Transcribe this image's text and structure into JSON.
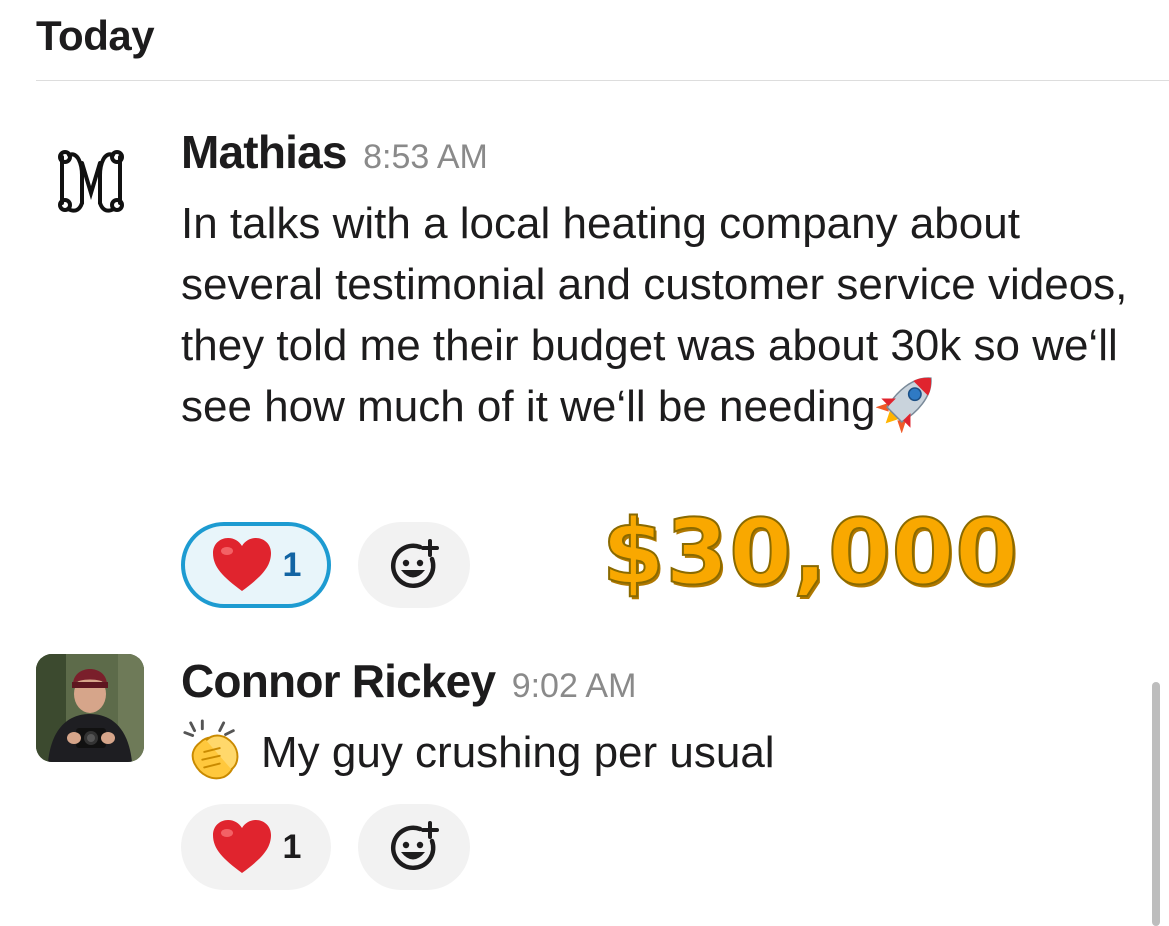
{
  "section": {
    "date_label": "Today"
  },
  "messages": [
    {
      "sender": "Mathias",
      "time": "8:53 AM",
      "text": "In talks with a local heating company about several testimonial and customer service videos, they told me their budget was about 30k so we‘ll see how much of it we‘ll be needing",
      "trailing_emoji": "rocket-icon",
      "reactions": [
        {
          "emoji": "heart-icon",
          "count": "1",
          "active": true
        }
      ],
      "add_reaction_icon": "add-reaction-icon"
    },
    {
      "sender": "Connor Rickey",
      "time": "9:02 AM",
      "leading_emoji": "clapping-hands-icon",
      "text": "My guy crushing per usual",
      "reactions": [
        {
          "emoji": "heart-icon",
          "count": "1",
          "active": false
        }
      ],
      "add_reaction_icon": "add-reaction-icon"
    }
  ],
  "overlay": {
    "amount_text": "$30,000",
    "color": "#f9a800"
  },
  "colors": {
    "active_reaction_border": "#1d9bd1",
    "active_reaction_bg": "#e8f5fa",
    "active_count": "#1264a3",
    "timestamp": "#8a8a8a",
    "heart": "#e0242e"
  }
}
